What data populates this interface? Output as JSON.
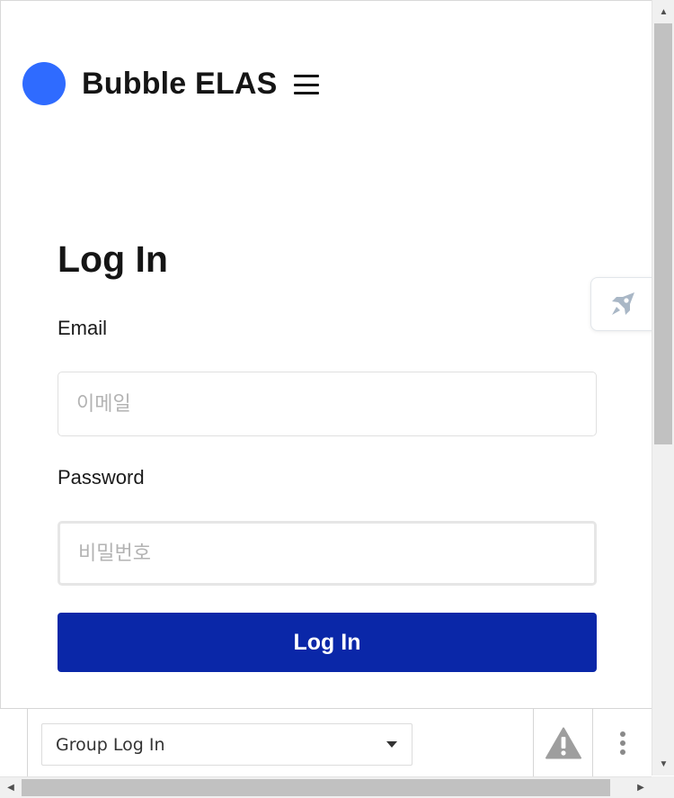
{
  "header": {
    "app_title": "Bubble ELAS",
    "logo_color": "#2f6bff",
    "menu_icon": "hamburger-menu-icon"
  },
  "login_form": {
    "heading": "Log In",
    "email_label": "Email",
    "email_placeholder": "이메일",
    "password_label": "Password",
    "password_placeholder": "비밀번호",
    "submit_label": "Log In",
    "submit_color": "#0a27a8"
  },
  "floating_widget": {
    "icon": "rocket-icon"
  },
  "debug_bar": {
    "group_select_value": "Group Log In",
    "warning_icon": "warning-icon",
    "more_icon": "more-vertical-icon"
  }
}
